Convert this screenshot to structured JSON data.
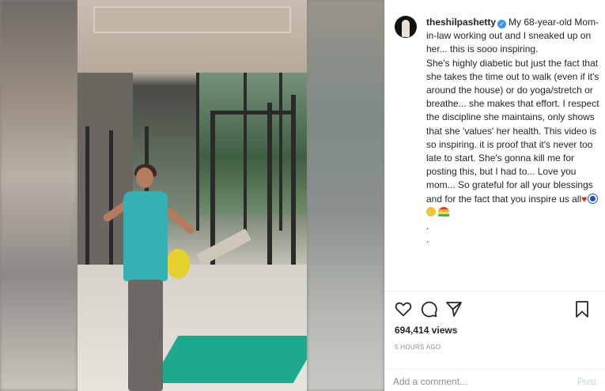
{
  "post": {
    "username": "theshilpashetty",
    "caption": "My 68-year-old Mom-in-law working out and I sneaked up on her... this is sooo inspiring.\nShe's highly diabetic but just the fact that she takes the time out to walk (even if it's around the house) or do yoga/stretch or breathe... she makes that effort. I respect the discipline she maintains, only shows that she 'values' her health. This video is so inspiring. it is proof that it's never too late to start. She's gonna kill me for posting this, but I had to... Love you mom... So grateful for all your blessings and for the fact that you inspire us all",
    "dots": ".\n.",
    "views": "694,414 views",
    "time_ago": "5 HOURS AGO"
  },
  "comment": {
    "placeholder": "Add a comment...",
    "post_label": "Post"
  },
  "icons": {
    "like": "heart-icon",
    "comment": "comment-icon",
    "share": "share-icon",
    "save": "bookmark-icon",
    "verified": "verified-badge-icon"
  },
  "colors": {
    "verified": "#3897f0",
    "post_disabled": "#b2dffc",
    "muted": "#8e8e8e"
  }
}
